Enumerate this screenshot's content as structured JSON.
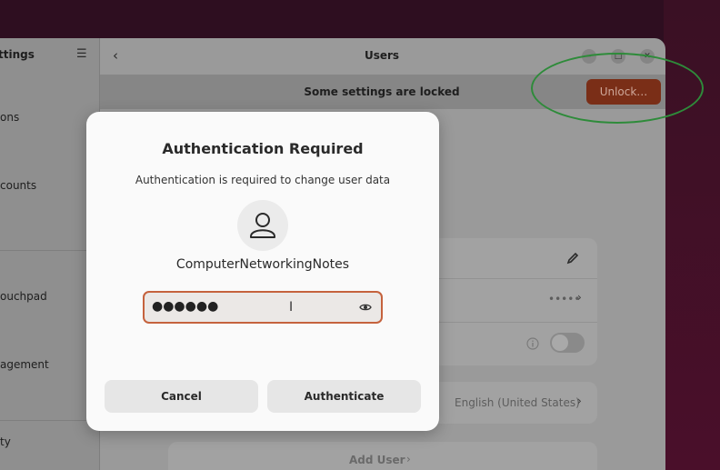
{
  "sidebar": {
    "title": "ttings",
    "items": [
      {
        "label": "ons"
      },
      {
        "label": "counts"
      },
      {
        "label": "ouchpad"
      },
      {
        "label": "agement"
      },
      {
        "label": "ty"
      }
    ]
  },
  "header": {
    "title": "Users"
  },
  "locked_bar": {
    "text": "Some settings are locked",
    "unlock_label": "Unlock…"
  },
  "background_cards": {
    "password_dots": "•••••",
    "language": "English (United States)",
    "add_user_label": "Add User"
  },
  "dialog": {
    "title": "Authentication Required",
    "subtitle": "Authentication is required to change user data",
    "username": "ComputerNetworkingNotes",
    "password_value": "●●●●●●",
    "cancel_label": "Cancel",
    "authenticate_label": "Authenticate"
  },
  "colors": {
    "accent": "#c5623d",
    "unlock_button": "#7a2e17",
    "highlight_ring": "#2e8b3a"
  },
  "icons": {
    "hamburger": "menu-icon",
    "back": "chevron-left-icon",
    "avatar": "user-icon",
    "reveal": "eye-icon",
    "edit": "pencil-icon",
    "info": "info-icon"
  }
}
